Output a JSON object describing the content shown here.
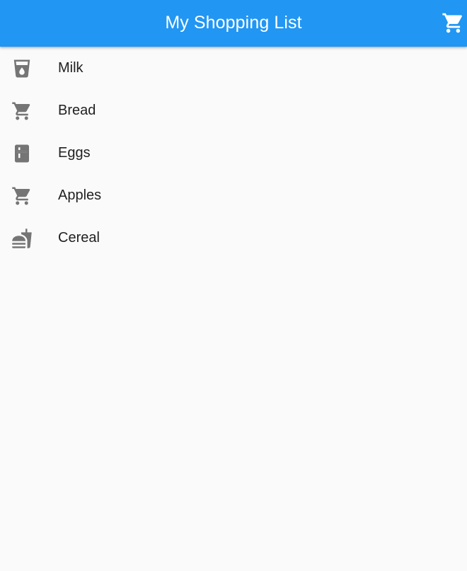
{
  "app_bar": {
    "title": "My Shopping List",
    "background_color": "#2196f3",
    "action_icon": "shopping-cart-icon"
  },
  "items": [
    {
      "label": "Milk",
      "icon": "local-drink-icon"
    },
    {
      "label": "Bread",
      "icon": "shopping-cart-icon"
    },
    {
      "label": "Eggs",
      "icon": "kitchen-icon"
    },
    {
      "label": "Apples",
      "icon": "shopping-cart-icon"
    },
    {
      "label": "Cereal",
      "icon": "fastfood-icon"
    }
  ],
  "colors": {
    "background": "#fafafa",
    "icon": "#757575",
    "text": "#212121"
  }
}
